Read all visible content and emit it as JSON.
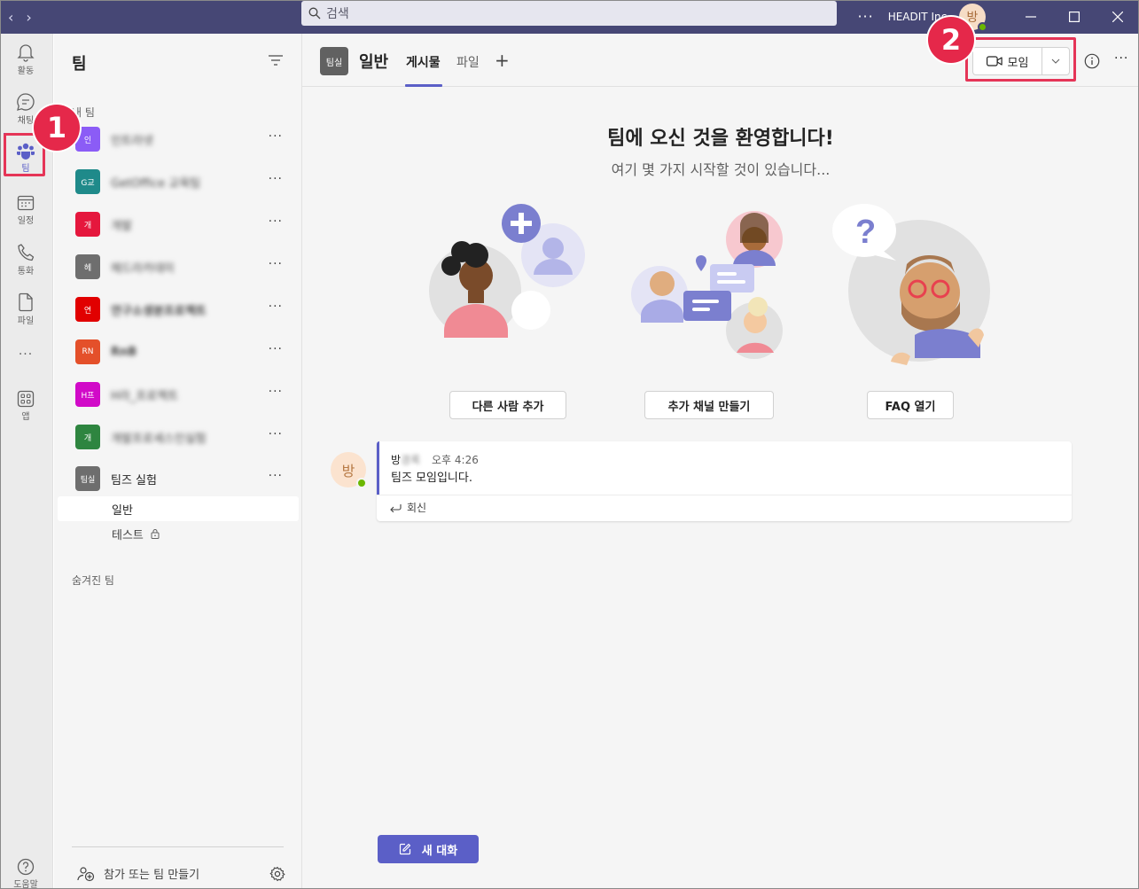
{
  "titlebar": {
    "search_placeholder": "검색",
    "more": "···",
    "org": "HEADIT Inc.",
    "avatar_initial": "방"
  },
  "rail": {
    "items": [
      {
        "label": "활동",
        "icon": "bell-icon"
      },
      {
        "label": "채팅",
        "icon": "chat-icon"
      },
      {
        "label": "팀",
        "icon": "teams-icon"
      },
      {
        "label": "일정",
        "icon": "calendar-icon"
      },
      {
        "label": "통화",
        "icon": "phone-icon"
      },
      {
        "label": "파일",
        "icon": "file-icon"
      },
      {
        "label": "···",
        "icon": "more-icon"
      },
      {
        "label": "앱",
        "icon": "apps-icon"
      },
      {
        "label": "도움말",
        "icon": "help-icon"
      }
    ]
  },
  "annotations": {
    "badge1": "1",
    "badge2": "2",
    "color": "#e5284a"
  },
  "teams_panel": {
    "title": "팀",
    "section_label": "내 팀",
    "teams": [
      {
        "initial": "인",
        "name": "인트라넷",
        "color": "#8b5cf6",
        "more": "···"
      },
      {
        "initial": "G교",
        "name": "GetOffice 교육팀",
        "color": "#1f8a8a",
        "more": "···"
      },
      {
        "initial": "개",
        "name": "개발",
        "color": "#e5173d",
        "more": "···"
      },
      {
        "initial": "헤",
        "name": "헤드라카데미",
        "color": "#6e6e6e",
        "more": "···"
      },
      {
        "initial": "연",
        "name": "연구소생분프로젝트",
        "color": "#e10000",
        "more": "···"
      },
      {
        "initial": "RN",
        "name": "RnB",
        "color": "#e4502a",
        "more": "···"
      },
      {
        "initial": "H프",
        "name": "H라_프로젝트",
        "color": "#d10ac8",
        "more": "···"
      },
      {
        "initial": "개",
        "name": "개발프로세스인실험",
        "color": "#2e8540",
        "more": "···"
      },
      {
        "initial": "팀실",
        "name": "팀즈 실험",
        "color": "#6e6e6e",
        "more": "···"
      }
    ],
    "channels": [
      {
        "name": "일반"
      },
      {
        "name": "테스트"
      }
    ],
    "hidden_label": "숨겨진 팀",
    "join_label": "참가 또는 팀 만들기"
  },
  "channel_header": {
    "team_initial": "팀실",
    "channel_name": "일반",
    "tabs": [
      "게시물",
      "파일"
    ],
    "add_tab": "+",
    "meet_label": "모임",
    "more": "···"
  },
  "welcome": {
    "title": "팀에 오신 것을 환영합니다!",
    "subtitle": "여기 몇 가지 시작할 것이 있습니다...",
    "actions": [
      "다른 사람 추가",
      "추가 채널 만들기",
      "FAQ 열기"
    ]
  },
  "message": {
    "avatar_initial": "방",
    "author_visible": "방",
    "author_hidden": "경록",
    "time": "오후 4:26",
    "text": "팀즈 모임입니다.",
    "reply_label": "회신"
  },
  "compose": {
    "new_conversation": "새 대화"
  }
}
